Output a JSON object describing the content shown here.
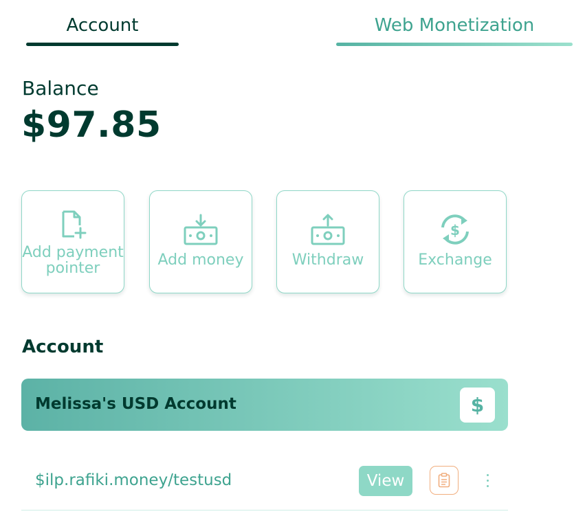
{
  "tabs": {
    "account": "Account",
    "web_monetization": "Web Monetization"
  },
  "balance": {
    "label": "Balance",
    "value": "$97.85"
  },
  "actions": [
    {
      "label_line1": "Add payment",
      "label_line2": "pointer",
      "icon": "add-file-icon"
    },
    {
      "label": "Add money",
      "icon": "cash-down-icon"
    },
    {
      "label": "Withdraw",
      "icon": "cash-up-icon"
    },
    {
      "label": "Exchange",
      "icon": "currency-exchange-icon"
    }
  ],
  "account_section": {
    "title": "Account",
    "card": {
      "name": "Melissa's USD Account",
      "badge": "$"
    },
    "payment_pointer": {
      "address": "$ilp.rafiki.money/testusd",
      "view_label": "View"
    }
  },
  "colors": {
    "primary": "#003a2f",
    "teal": "#56b3a3",
    "teal_light": "#8ed8c6",
    "orange": "#f1ae7e"
  }
}
